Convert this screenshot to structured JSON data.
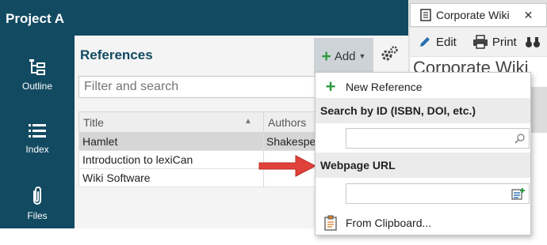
{
  "project": {
    "title": "Project A"
  },
  "nav": {
    "outline": "Outline",
    "index": "Index",
    "files": "Files"
  },
  "references": {
    "title": "References",
    "add_label": "Add",
    "filter_placeholder": "Filter and search",
    "columns": [
      "Title",
      "Authors"
    ],
    "rows": [
      {
        "title": "Hamlet",
        "author": "Shakespe"
      },
      {
        "title": "Introduction to lexiCan",
        "author": ""
      },
      {
        "title": "Wiki Software",
        "author": ""
      }
    ]
  },
  "menu": {
    "new_reference": "New Reference",
    "search_by_id": "Search by ID (ISBN, DOI, etc.)",
    "webpage_url": "Webpage URL",
    "from_clipboard": "From Clipboard..."
  },
  "wiki": {
    "tab_title": "Corporate Wiki",
    "edit": "Edit",
    "print": "Print",
    "heading": "Corporate Wiki"
  },
  "colors": {
    "nav_bg": "#124a61",
    "accent_green": "#2e9a3d",
    "arrow_red": "#e0413a"
  }
}
